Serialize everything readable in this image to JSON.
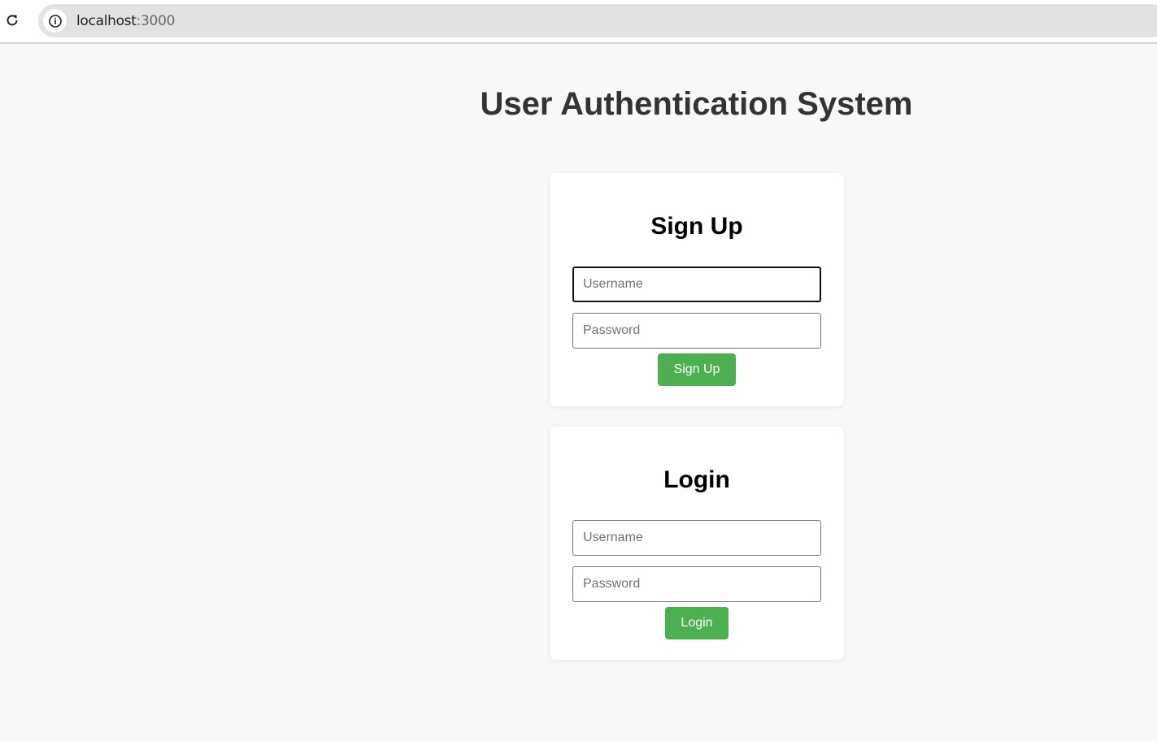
{
  "browser": {
    "url_host": "localhost",
    "url_port": ":3000",
    "reload_icon": "reload-icon",
    "info_icon": "info-icon"
  },
  "page": {
    "title": "User Authentication System"
  },
  "signup": {
    "title": "Sign Up",
    "username_placeholder": "Username",
    "username_value": "",
    "password_placeholder": "Password",
    "password_value": "",
    "button_label": "Sign Up"
  },
  "login": {
    "title": "Login",
    "username_placeholder": "Username",
    "username_value": "",
    "password_placeholder": "Password",
    "password_value": "",
    "button_label": "Login"
  },
  "colors": {
    "button_bg": "#4caf50",
    "page_bg": "#f8f8f8",
    "title_text": "#333333"
  }
}
